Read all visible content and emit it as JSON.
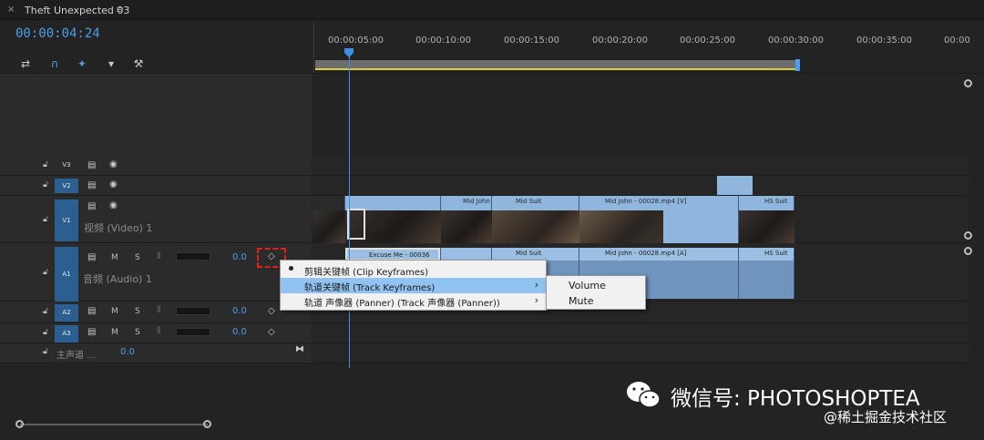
{
  "sequence": {
    "tab_title": "Theft Unexpected 03",
    "close_glyph": "×",
    "menu_glyph": "≡",
    "timecode": "00:00:04:24"
  },
  "ruler": {
    "labels": [
      "00:00:05:00",
      "00:00:10:00",
      "00:00:15:00",
      "00:00:20:00",
      "00:00:25:00",
      "00:00:30:00",
      "00:00:35:00",
      "00:00"
    ]
  },
  "tracks": {
    "v3": {
      "label": "V3"
    },
    "v2": {
      "label": "V2"
    },
    "v1": {
      "label": "V1",
      "name": "视频 (Video) 1"
    },
    "a1": {
      "label": "A1",
      "name": "音频 (Audio) 1",
      "value": "0.0"
    },
    "a2": {
      "label": "A2",
      "value": "0.0"
    },
    "a3": {
      "label": "A3",
      "value": "0.0"
    },
    "master": {
      "name": "主声道 ...",
      "value": "0.0"
    },
    "m_label": "M",
    "s_label": "S"
  },
  "clips": {
    "video": [
      "Mid John",
      "Mid Suit",
      "Mid John - 00028.mp4 [V]",
      "HS Suit"
    ],
    "audio": [
      "Excuse Me - 00036",
      "Mid Suit",
      "Mid John - 00028.mp4 [A]",
      "HS Suit"
    ]
  },
  "context_menu": {
    "items": [
      "剪辑关键帧 (Clip Keyframes)",
      "轨道关键帧 (Track Keyframes)",
      "轨道 声像器 (Panner) (Track 声像器 (Panner))"
    ],
    "submenu_arrow": "›",
    "submenu": [
      "Volume",
      "Mute"
    ]
  },
  "watermark": {
    "main": "微信号: PHOTOSHOPTEA",
    "sub": "@稀土掘金技术社区"
  },
  "colors": {
    "accent": "#4d9ee8",
    "clip_video": "#8fb6dd",
    "clip_audio": "#6f95bf",
    "highlight": "#90c3f0"
  },
  "icons": [
    "snap-icon",
    "magnet-icon",
    "linked-selection-icon",
    "marker-icon",
    "wrench-icon",
    "lock-icon",
    "film-icon",
    "eye-icon",
    "microphone-icon",
    "keyframe-icon"
  ]
}
